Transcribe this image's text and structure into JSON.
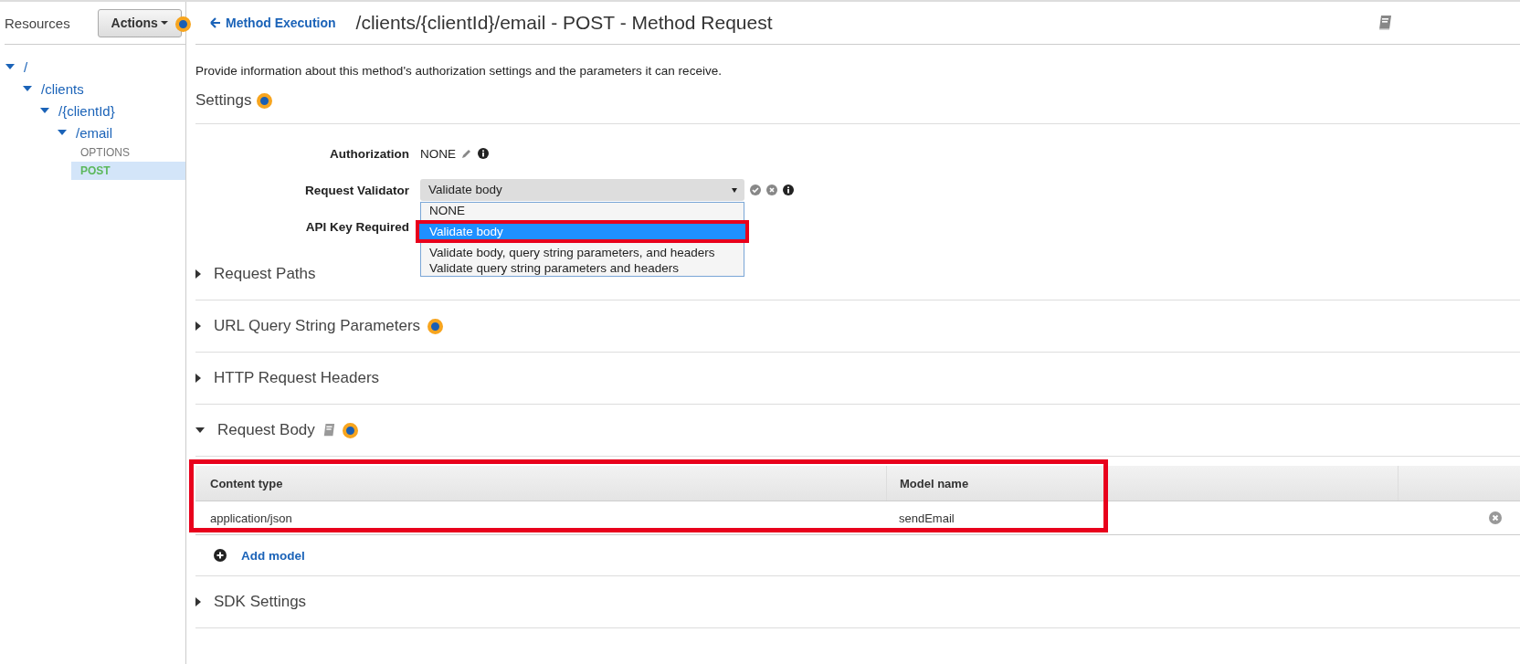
{
  "sidebar": {
    "title": "Resources",
    "actions_button": "Actions",
    "tree": [
      {
        "label": "/",
        "kind": "resource",
        "expanded": true,
        "children": [
          {
            "label": "/clients",
            "kind": "resource",
            "expanded": true,
            "children": [
              {
                "label": "/{clientId}",
                "kind": "resource",
                "expanded": true,
                "children": [
                  {
                    "label": "/email",
                    "kind": "resource",
                    "expanded": true,
                    "children": [
                      {
                        "label": "OPTIONS",
                        "kind": "method",
                        "selected": false
                      },
                      {
                        "label": "POST",
                        "kind": "method",
                        "selected": true
                      }
                    ]
                  }
                ]
              }
            ]
          }
        ]
      }
    ]
  },
  "header": {
    "back_link": "Method Execution",
    "title": "/clients/{clientId}/email - POST - Method Request"
  },
  "description": "Provide information about this method's authorization settings and the parameters it can receive.",
  "settings": {
    "heading": "Settings",
    "fields": [
      {
        "label": "Authorization",
        "kind": "text",
        "value": "NONE"
      },
      {
        "label": "Request Validator",
        "kind": "select",
        "value": "Validate body",
        "open": true,
        "options": [
          {
            "label": "NONE",
            "selected": false,
            "highlighted": false
          },
          {
            "label": "Validate body",
            "selected": true,
            "highlighted": true
          },
          {
            "label": "Validate body, query string parameters, and headers",
            "selected": false,
            "highlighted": false
          },
          {
            "label": "Validate query string parameters and headers",
            "selected": false,
            "highlighted": false
          }
        ]
      },
      {
        "label": "API Key Required",
        "kind": "hidden"
      }
    ]
  },
  "sections": [
    {
      "title": "Request Paths",
      "expanded": false,
      "doc": false,
      "tip": false
    },
    {
      "title": "URL Query String Parameters",
      "expanded": false,
      "doc": false,
      "tip": true
    },
    {
      "title": "HTTP Request Headers",
      "expanded": false,
      "doc": false,
      "tip": false
    },
    {
      "title": "Request Body",
      "expanded": true,
      "doc": true,
      "tip": true,
      "table": {
        "highlighted": true,
        "columns": [
          "Content type",
          "Model name"
        ],
        "rows": [
          {
            "content_type": "application/json",
            "model_name": "sendEmail"
          }
        ]
      },
      "add_button": "Add model"
    },
    {
      "title": "SDK Settings",
      "expanded": false,
      "doc": false,
      "tip": false
    }
  ]
}
